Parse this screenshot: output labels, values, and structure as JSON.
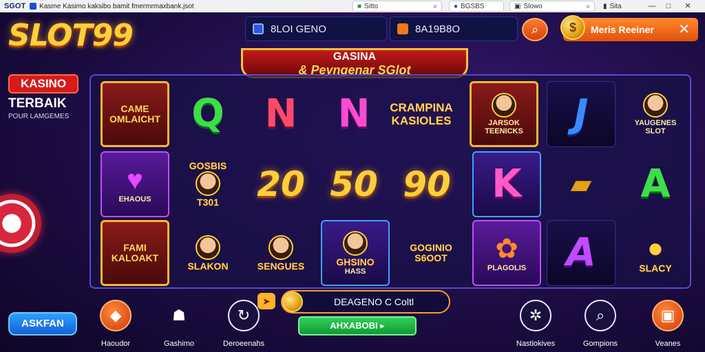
{
  "browser": {
    "site_label": "SGOT",
    "url": "Kasme Kasimo kaksibo bamit fmermrmaxbank.jsot",
    "tab1": "Sitto",
    "tab2": "BGSBS",
    "tab3": "Slowo",
    "tab4": "Sita"
  },
  "header": {
    "logo": "SLOT99",
    "balance1": "8LOI GENO",
    "balance2": "8A19B8O",
    "cta_label": "Meris Reeiner"
  },
  "left": {
    "kasino": "KASINO",
    "terbaik": "TERBAIK",
    "terbaik_sub": "POUR LAMGEMES",
    "register": "ASKFAN"
  },
  "banner": {
    "line1": "GASINA",
    "line2": "& Peyngenar SGlot"
  },
  "tiles": {
    "r1c1": "CAME OMLAICHT",
    "r1c2": "Q",
    "r1c3": "N",
    "r1c4": "N",
    "r1c5": "CRAMPINA KASIOLES",
    "r1c6a": "JARSOK",
    "r1c6b": "TEENICKS",
    "r1c7": "J",
    "r1c8a": "YAUGENES",
    "r1c8b": "SLOT",
    "r2c1": "EHAOUS",
    "r2c2a": "GOSBIS",
    "r2c2b": "T301",
    "r2c3": "20",
    "r2c4": "50",
    "r2c5": "90",
    "r2c6": "K",
    "r2c7": "",
    "r2c8": "A",
    "r3c1": "FAMI KALOAKT",
    "r3c2": "SLAKON",
    "r3c3": "SENGUES",
    "r3c4a": "GHSINO",
    "r3c4b": "HASS",
    "r3c5a": "GOGINIO",
    "r3c5b": "S6OOT",
    "r3c6": "PLAGOLIS",
    "r3c7": "A",
    "r3c8": "SLACY"
  },
  "footer": {
    "bonus": "DEAGENO C Coltl",
    "play": "AHXABOBI",
    "nav": [
      "Haoudor",
      "Gashimo",
      "Deroeenahs",
      "Nastiokives",
      "Gompions",
      "Veanes"
    ]
  },
  "colors": {
    "accent_orange": "#e2510d",
    "gold": "#ffcf3a",
    "panel_bg": "#1d0d44",
    "green": "#129a32",
    "blue": "#1860d8"
  }
}
